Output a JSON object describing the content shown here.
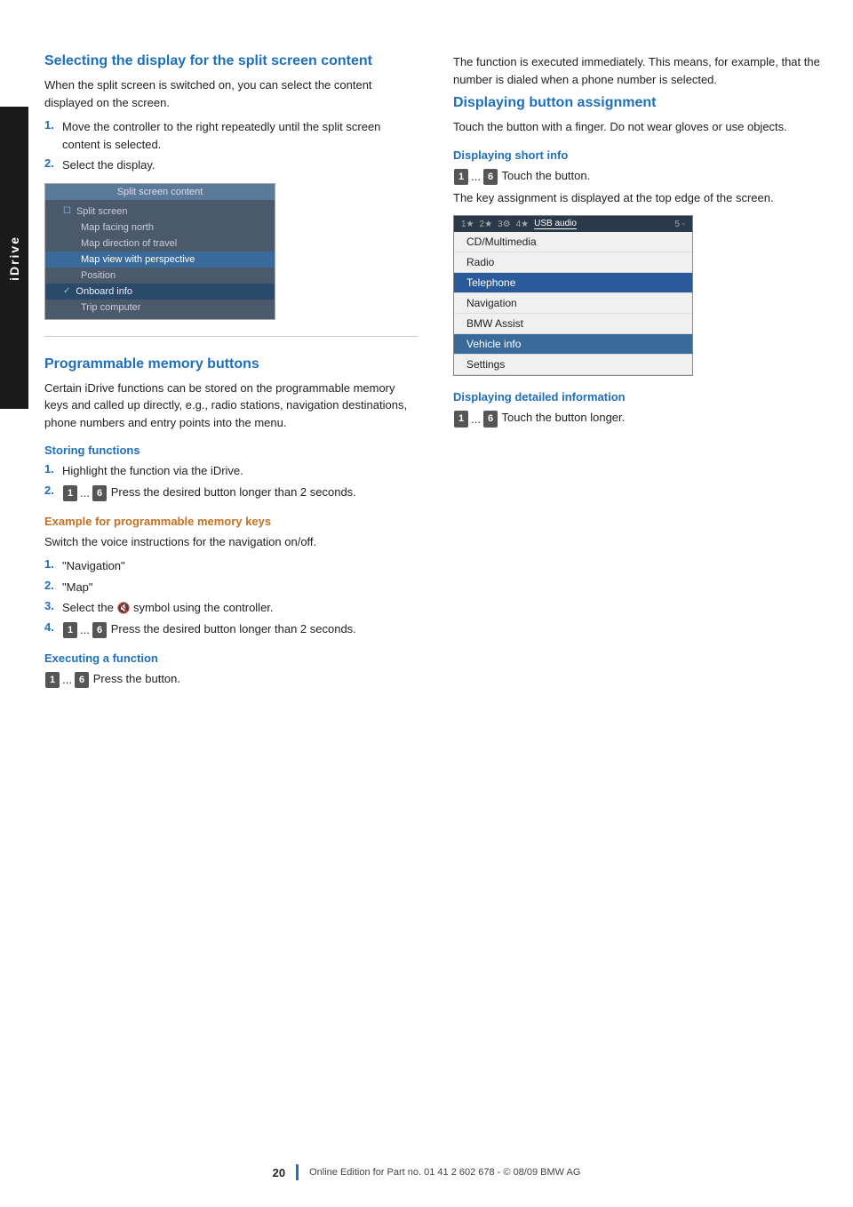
{
  "side_tab": {
    "label": "iDrive"
  },
  "left_col": {
    "section1": {
      "heading": "Selecting the display for the split screen content",
      "intro": "When the split screen is switched on, you can select the content displayed on the screen.",
      "steps": [
        "Move the controller to the right repeatedly until the split screen content is selected.",
        "Select the display."
      ],
      "split_screen_menu": {
        "title": "Split screen content",
        "items": [
          {
            "label": "Split screen",
            "icon": "checkbox",
            "state": "checked"
          },
          {
            "label": "Map facing north",
            "state": "normal"
          },
          {
            "label": "Map direction of travel",
            "state": "normal"
          },
          {
            "label": "Map view with perspective",
            "state": "highlighted"
          },
          {
            "label": "Position",
            "state": "normal"
          },
          {
            "label": "Onboard info",
            "state": "selected"
          },
          {
            "label": "Trip computer",
            "state": "normal"
          }
        ]
      }
    },
    "section2": {
      "heading": "Programmable memory buttons",
      "intro": "Certain iDrive functions can be stored on the programmable memory keys and called up directly, e.g., radio stations, navigation destinations, phone numbers and entry points into the menu.",
      "storing": {
        "heading": "Storing functions",
        "steps": [
          {
            "num": "1",
            "text": "Highlight the function via the iDrive."
          },
          {
            "num": "2",
            "text": "Press the desired button longer than 2 seconds.",
            "has_keys": true
          }
        ]
      },
      "example": {
        "heading": "Example for programmable memory keys",
        "intro": "Switch the voice instructions for the navigation on/off.",
        "steps": [
          {
            "num": "1",
            "text": "\"Navigation\""
          },
          {
            "num": "2",
            "text": "\"Map\""
          },
          {
            "num": "3",
            "text": "Select the 🔔 symbol using the controller."
          },
          {
            "num": "4",
            "text": "Press the desired button longer than 2 seconds.",
            "has_keys": true
          }
        ]
      },
      "executing": {
        "heading": "Executing a function",
        "text": "Press the button.",
        "has_keys": true
      }
    }
  },
  "right_col": {
    "intro_text": "The function is executed immediately. This means, for example, that the number is dialed when a phone number is selected.",
    "displaying_button": {
      "heading": "Displaying button assignment",
      "intro": "Touch the button with a finger. Do not wear gloves or use objects.",
      "short_info": {
        "heading": "Displaying short info",
        "text": "Touch the button.",
        "suffix": "The key assignment is displayed at the top edge of the screen.",
        "has_keys": true
      },
      "menu": {
        "top_bar": "1 ★  2 ★  3 ⚙  4 ★  USB audio  5 -",
        "items": [
          {
            "label": "CD/Multimedia",
            "state": "normal"
          },
          {
            "label": "Radio",
            "state": "normal"
          },
          {
            "label": "Telephone",
            "state": "selected"
          },
          {
            "label": "Navigation",
            "state": "normal"
          },
          {
            "label": "BMW Assist",
            "state": "normal"
          },
          {
            "label": "Vehicle info",
            "state": "highlighted"
          },
          {
            "label": "Settings",
            "state": "normal"
          }
        ]
      },
      "detailed_info": {
        "heading": "Displaying detailed information",
        "text": "Touch the button longer.",
        "has_keys": true
      }
    }
  },
  "footer": {
    "page_number": "20",
    "text": "Online Edition for Part no. 01 41 2 602 678 - © 08/09 BMW AG"
  },
  "keys": {
    "key1": "1",
    "key6": "6",
    "ellipsis": "..."
  }
}
